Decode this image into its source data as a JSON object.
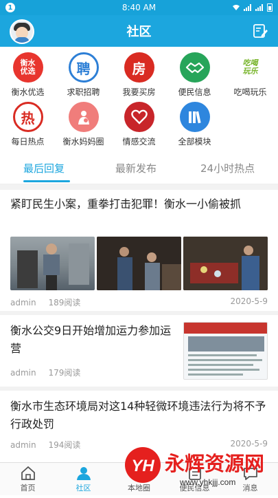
{
  "status_bar": {
    "badge": "1",
    "time": "8:40 AM"
  },
  "header": {
    "title": "社区"
  },
  "modules": [
    {
      "label": "衡水优选",
      "icon_text": "衡水\n优选",
      "color": "#e8352e",
      "icon": "hengshui-youxuan-icon"
    },
    {
      "label": "求职招聘",
      "icon_text": "聘",
      "color": "#2d7fd6",
      "icon": "recruit-icon"
    },
    {
      "label": "我要买房",
      "icon_text": "房",
      "color": "#d92b22",
      "icon": "house-icon"
    },
    {
      "label": "便民信息",
      "icon_text": "",
      "color": "#27a55a",
      "icon": "handshake-icon"
    },
    {
      "label": "吃喝玩乐",
      "icon_text": "吃喝\n玩乐",
      "color": "#ffffff",
      "icon": "food-fun-icon"
    },
    {
      "label": "每日热点",
      "icon_text": "热",
      "color": "#d92b22",
      "icon": "hot-icon"
    },
    {
      "label": "衡水妈妈圈",
      "icon_text": "",
      "color": "#f07d7b",
      "icon": "mother-icon"
    },
    {
      "label": "情感交流",
      "icon_text": "",
      "color": "#c8252a",
      "icon": "heart-icon"
    },
    {
      "label": "全部模块",
      "icon_text": "",
      "color": "#2e86de",
      "icon": "all-modules-icon"
    }
  ],
  "tabs": [
    {
      "label": "最后回复",
      "active": true
    },
    {
      "label": "最新发布",
      "active": false
    },
    {
      "label": "24小时热点",
      "active": false
    }
  ],
  "posts": [
    {
      "title": "紧盯民生小案，重拳打击犯罪！衡水一小偷被抓",
      "author": "admin",
      "reads": "189阅读",
      "date": "2020-5-9"
    },
    {
      "title": "衡水公交9日开始增加运力参加运营",
      "author": "admin",
      "reads": "179阅读",
      "date": ""
    },
    {
      "title": "衡水市生态环境局对这14种轻微环境违法行为将不予行政处罚",
      "author": "admin",
      "reads": "194阅读",
      "date": "2020-5-9"
    }
  ],
  "bottom_nav": [
    {
      "label": "首页",
      "icon": "home-icon",
      "active": false
    },
    {
      "label": "社区",
      "icon": "community-icon",
      "active": true
    },
    {
      "label": "本地圈",
      "icon": "local-circle-icon",
      "active": false
    },
    {
      "label": "便民信息",
      "icon": "info-icon",
      "active": false
    },
    {
      "label": "消息",
      "icon": "message-icon",
      "active": false
    }
  ],
  "watermark": {
    "brand": "永辉资源网",
    "logo": "YH",
    "url": "www.yhkjjj.com"
  },
  "colors": {
    "accent": "#1ca6de",
    "status_bar": "#17a2d9"
  }
}
